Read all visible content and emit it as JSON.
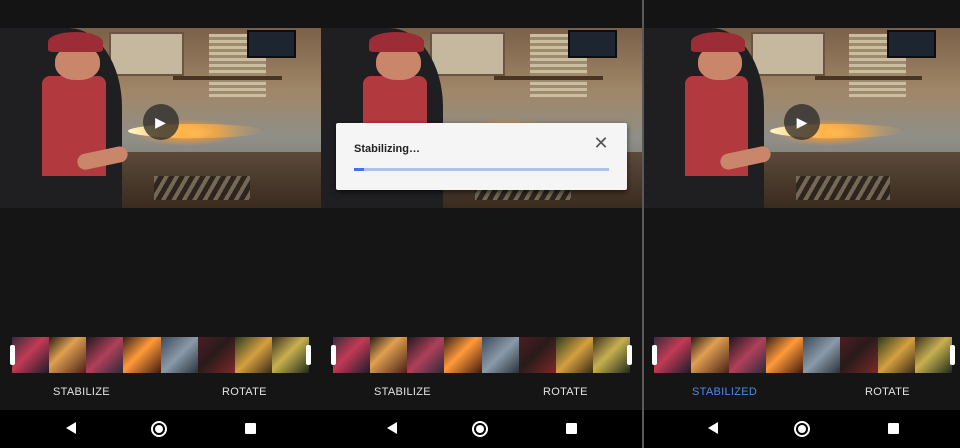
{
  "screens": [
    {
      "id": "before",
      "video": {
        "play_icon": "play-icon"
      },
      "dialog": null,
      "actions": {
        "stabilize_label": "STABILIZE",
        "rotate_label": "ROTATE"
      },
      "nav": {
        "back_icon": "back-icon",
        "home_icon": "home-icon",
        "recents_icon": "recents-icon"
      }
    },
    {
      "id": "stabilizing",
      "video": {
        "play_icon": null
      },
      "dialog": {
        "title": "Stabilizing…",
        "close_icon": "close-icon",
        "progress_fraction": 0.04
      },
      "actions": {
        "stabilize_label": "STABILIZE",
        "rotate_label": "ROTATE"
      },
      "nav": {
        "back_icon": "back-icon",
        "home_icon": "home-icon",
        "recents_icon": "recents-icon"
      }
    },
    {
      "id": "after",
      "video": {
        "play_icon": "play-icon"
      },
      "dialog": null,
      "actions": {
        "stabilize_label": "STABILIZED",
        "rotate_label": "ROTATE"
      },
      "nav": {
        "back_icon": "back-icon",
        "home_icon": "home-icon",
        "recents_icon": "recents-icon"
      }
    }
  ],
  "glyphs": {
    "play": "▶",
    "close": "✕"
  },
  "colors": {
    "active_action": "#4d8ae8",
    "progress": "#3b78e7",
    "progress_track": "#a8c4ef"
  }
}
